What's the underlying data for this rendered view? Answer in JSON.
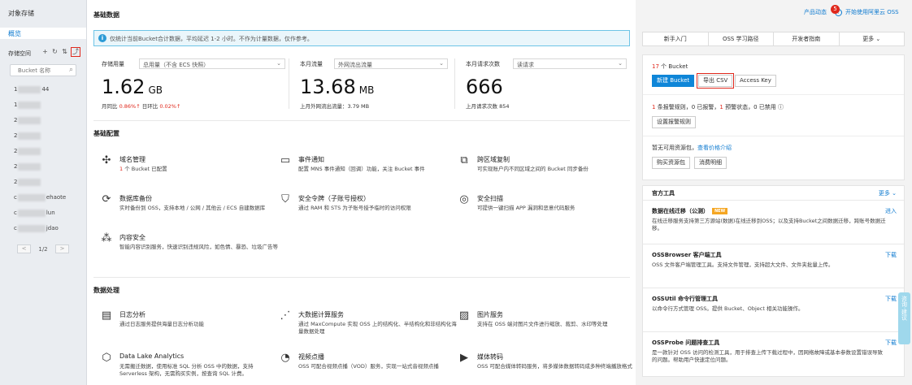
{
  "sidebar": {
    "title": "对象存储",
    "overview": "概览",
    "bucket_label": "存储空间",
    "search_placeholder": "Bucket 名称",
    "buckets": [
      {
        "prefix": "1",
        "suffix": "44"
      },
      {
        "prefix": "1",
        "suffix": ""
      },
      {
        "prefix": "2",
        "suffix": ""
      },
      {
        "prefix": "2",
        "suffix": ""
      },
      {
        "prefix": "2",
        "suffix": ""
      },
      {
        "prefix": "2",
        "suffix": ""
      },
      {
        "prefix": "2",
        "suffix": ""
      },
      {
        "prefix": "c",
        "suffix": "ehaote"
      },
      {
        "prefix": "c",
        "suffix": "lun"
      },
      {
        "prefix": "c",
        "suffix": "jdao"
      }
    ],
    "pager": {
      "prev": "<",
      "page": "1/2",
      "next": ">"
    }
  },
  "main": {
    "basic_data_title": "基础数据",
    "notice": "仅统计当前Bucket合计数据，平均延迟 1-2 小时。不作为计量数据，仅作参考。",
    "stats": [
      {
        "label": "存储用量",
        "select": "总用量（不含 ECS 快照）",
        "value": "1.62",
        "unit": "GB",
        "sub1_label": "月同比 ",
        "sub1_value": "0.86%↑",
        "sub2_label": " 日环比 ",
        "sub2_value": "0.02%↑"
      },
      {
        "label": "本月流量",
        "select": "外网流出流量",
        "value": "13.68",
        "unit": "MB",
        "sub": "上月外网流出流量：3.79 MB"
      },
      {
        "label": "本月请求次数",
        "select": "读请求",
        "value": "666",
        "unit": "",
        "sub": "上月请求次数 854"
      }
    ],
    "basic_config_title": "基础配置",
    "config": [
      {
        "icon": "domain-icon",
        "glyph": "✣",
        "name": "域名管理",
        "desc_hl": "1",
        "desc": " 个 Bucket 已配置"
      },
      {
        "icon": "event-icon",
        "glyph": "▭",
        "name": "事件通知",
        "desc": "配置 MNS 事件通知（回调）功能，关注 Bucket 事件"
      },
      {
        "icon": "replication-icon",
        "glyph": "⧉",
        "name": "跨区域复制",
        "desc": "可实现账户内不同区域之间的 Bucket 同步备份"
      },
      {
        "icon": "backup-icon",
        "glyph": "⟳",
        "name": "数据库备份",
        "desc": "实时备份到 OSS，支持本地 / 公网 / 其他云 / ECS 自建数据库"
      },
      {
        "icon": "token-icon",
        "glyph": "⛉",
        "name": "安全令牌（子账号授权）",
        "desc": "通过 RAM 和 STS 为子账号授予临时的访问权限"
      },
      {
        "icon": "scan-icon",
        "glyph": "◎",
        "name": "安全扫描",
        "desc": "可提供一键扫描 APP 漏洞和恶意代码服务"
      },
      {
        "icon": "content-security-icon",
        "glyph": "⁂",
        "name": "内容安全",
        "desc": "智能内容识别服务，快速识别违规风险，如色情、暴恐、垃圾广告等"
      }
    ],
    "data_process_title": "数据处理",
    "process": [
      {
        "icon": "log-icon",
        "glyph": "▤",
        "name": "日志分析",
        "desc": "通过日志服务提供海量日志分析功能"
      },
      {
        "icon": "compute-icon",
        "glyph": "⋰",
        "name": "大数据计算服务",
        "desc": "通过 MaxCompute 实现 OSS 上的结构化、半结构化和非结构化海量数据处理"
      },
      {
        "icon": "image-icon",
        "glyph": "▨",
        "name": "图片服务",
        "desc": "支持在 OSS 端对图片文件进行缩放、裁剪、水印等处理"
      },
      {
        "icon": "datalake-icon",
        "glyph": "⬡",
        "name": "Data Lake Analytics",
        "desc": "无需搬迁数据，使用标准 SQL 分析 OSS 中的数据，支持 Serverless 架构，无需购买实例，按查询 SQL 计费。"
      },
      {
        "icon": "video-icon",
        "glyph": "◔",
        "name": "视频点播",
        "desc": "OSS 可配合视频点播（VOD）服务，实现一站式音视频点播"
      },
      {
        "icon": "transcode-icon",
        "glyph": "▶",
        "name": "媒体转码",
        "desc": "OSS 可配合媒体转码服务，将多媒体数据转码成多种终端播放格式"
      }
    ]
  },
  "header": {
    "product_news": "产品动态",
    "news_count": "5",
    "help": "开始使用阿里云 OSS"
  },
  "right": {
    "tabs": [
      "新手入门",
      "OSS 学习路径",
      "开发者指南",
      "更多"
    ],
    "bucket_count": "17",
    "bucket_count_suffix": " 个 Bucket",
    "new_bucket": "新建 Bucket",
    "export_csv": "导出 CSV",
    "access_key": "Access Key",
    "alarm": {
      "a": "1",
      "b": " 条报警规则，",
      "c": "0",
      "d": " 已报警，",
      "e": "1",
      "f": " 预警状态，",
      "g": "0",
      "h": " 已禁用"
    },
    "alarm_button": "设置报警规则",
    "resource_text": "暂无可用资源包，",
    "resource_link": "查看价格介绍",
    "buy_button": "购买资源包",
    "consume_button": "消费明细",
    "tools_title": "官方工具",
    "tools_more": "更多",
    "tools": [
      {
        "name": "数据在线迁移（公测）",
        "new": "NEW",
        "link": "进入",
        "desc": "在线迁移服务支持第三方源站(数据)在线迁移到OSS；以及支持Bucket之间数据迁移，跨账号数据迁移。"
      },
      {
        "name": "OSSBrowser 客户端工具",
        "link": "下载",
        "desc": "OSS 文件客户端管理工具。支持文件管理，支持超大文件、文件夹批量上传。"
      },
      {
        "name": "OSSUtil 命令行管理工具",
        "link": "下载",
        "desc": "以命令行方式管理 OSS。提供 Bucket、Object 相关功能操作。"
      },
      {
        "name": "OSSProbe 问题排查工具",
        "link": "下载",
        "desc": "是一款针对 OSS 访问的检测工具，用于排查上传下载过程中，因网络故障或基本参数设置错误导致的问题。帮助用户快速定位问题。"
      }
    ],
    "float_label": "咨询·建议"
  }
}
